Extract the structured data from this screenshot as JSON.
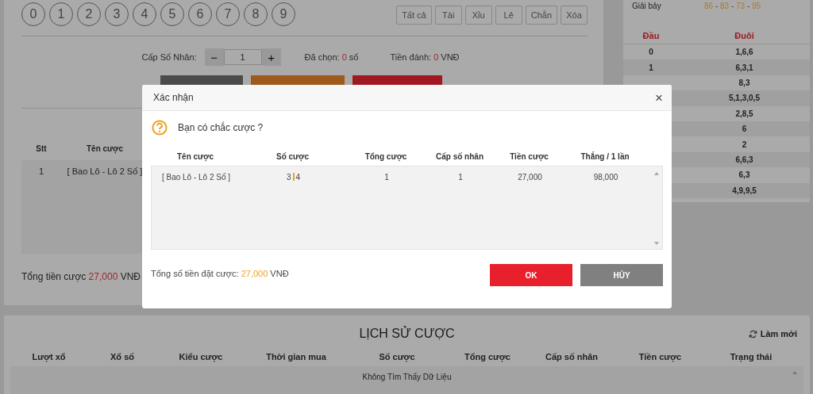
{
  "number_picker": {
    "digits": [
      "0",
      "1",
      "2",
      "3",
      "4",
      "5",
      "6",
      "7",
      "8",
      "9"
    ],
    "filters": [
      "Tất cả",
      "Tài",
      "Xỉu",
      "Lẻ",
      "Chẵn",
      "Xóa"
    ]
  },
  "multiplier": {
    "label": "Cấp Số Nhân:",
    "minus": "−",
    "value": "1",
    "plus": "+"
  },
  "selected_count": {
    "label": "Đã chọn:",
    "value": "0",
    "unit": "số"
  },
  "stake": {
    "label": "Tiền đánh:",
    "value": "0",
    "unit": "VNĐ"
  },
  "action_buttons": [
    {
      "color": "#4b4b4b"
    },
    {
      "color": "#9e5a1c"
    },
    {
      "color": "#a01822"
    }
  ],
  "bet_table": {
    "columns": [
      "Stt",
      "Tên cược"
    ],
    "rows": [
      [
        "1",
        "[ Bao Lô - Lô 2 Số ]"
      ]
    ]
  },
  "total": {
    "label": "Tổng tiền cược",
    "value": "27,000",
    "unit": "VNĐ"
  },
  "results": {
    "prize_label": "Giải bảy",
    "prize_numbers": [
      "86",
      "83",
      "73",
      "95"
    ],
    "prize_separator": "-",
    "columns": [
      "Đầu",
      "Đuôi"
    ],
    "rows": [
      {
        "head": "0",
        "tail": "1,6,6"
      },
      {
        "head": "1",
        "tail": "6,3,1"
      },
      {
        "tail": "8,3"
      },
      {
        "tail": "5,1,3,0,5"
      },
      {
        "tail": "2,8,5"
      },
      {
        "tail": "6"
      },
      {
        "tail": "2"
      },
      {
        "tail": "6,6,3"
      },
      {
        "tail": "6,3"
      },
      {
        "tail": "4,9,9,5"
      }
    ]
  },
  "history": {
    "title": "LỊCH SỬ CƯỢC",
    "refresh": "Làm mới",
    "columns": [
      "Lượt xổ",
      "Xổ số",
      "Kiểu cược",
      "Thời gian mua",
      "Số cược",
      "Tổng cược",
      "Cấp số nhân",
      "Tiền cược",
      "Trạng thái"
    ],
    "empty": "Không Tìm Thấy Dữ Liệu"
  },
  "dialog": {
    "title": "Xác nhận",
    "close": "×",
    "question": "Bạn có chắc cược ?",
    "columns": [
      "Tên cược",
      "Số cược",
      "Tổng cược",
      "Cấp số nhân",
      "Tiền cược",
      "Thắng / 1 lần"
    ],
    "rows": [
      {
        "name": "[ Bao Lô - Lô 2 Số ]",
        "numbers": [
          "3",
          "4"
        ],
        "total": "1",
        "multiplier": "1",
        "stake": "27,000",
        "win": "98,000"
      }
    ],
    "summary": {
      "label": "Tổng số tiền đặt cược:",
      "value": "27,000",
      "unit": "VNĐ"
    },
    "ok": "OK",
    "cancel": "HỦY"
  }
}
